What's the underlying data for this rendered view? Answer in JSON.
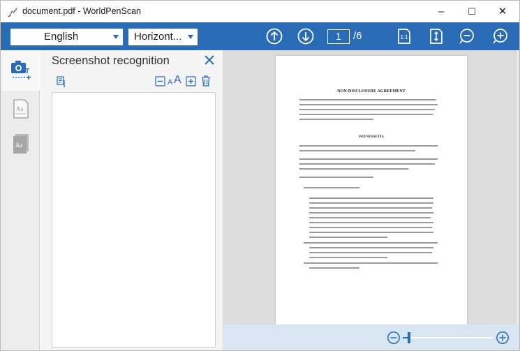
{
  "window": {
    "title": "document.pdf - WorldPenScan",
    "controls": {
      "minimize": "–",
      "maximize": "☐",
      "close": "✕"
    }
  },
  "toolbar": {
    "language": {
      "selected": "English"
    },
    "orientation": {
      "selected": "Horizont..."
    },
    "page": {
      "current": "1",
      "total": "/6"
    },
    "icons": [
      "arrow-up-circle-icon",
      "arrow-down-circle-icon",
      "actual-size-icon",
      "fit-page-icon",
      "zoom-out-icon",
      "zoom-in-icon"
    ]
  },
  "rail": {
    "items": [
      "screenshot-recognition-icon",
      "text-recognition-icon",
      "document-recognition-icon"
    ]
  },
  "panel": {
    "title": "Screenshot recognition",
    "font_small": "A",
    "font_large": "A",
    "recognized_text": ""
  },
  "document": {
    "title": "NON-DISCLOSURE AGREEMENT",
    "section_heading": "WITNESSETH:"
  },
  "zoom": {
    "level_fraction": 0.05
  },
  "colors": {
    "accent": "#2a6bb6",
    "toolbar_bg": "#2a6bb6",
    "zoombar_bg": "#d8e6f4"
  }
}
